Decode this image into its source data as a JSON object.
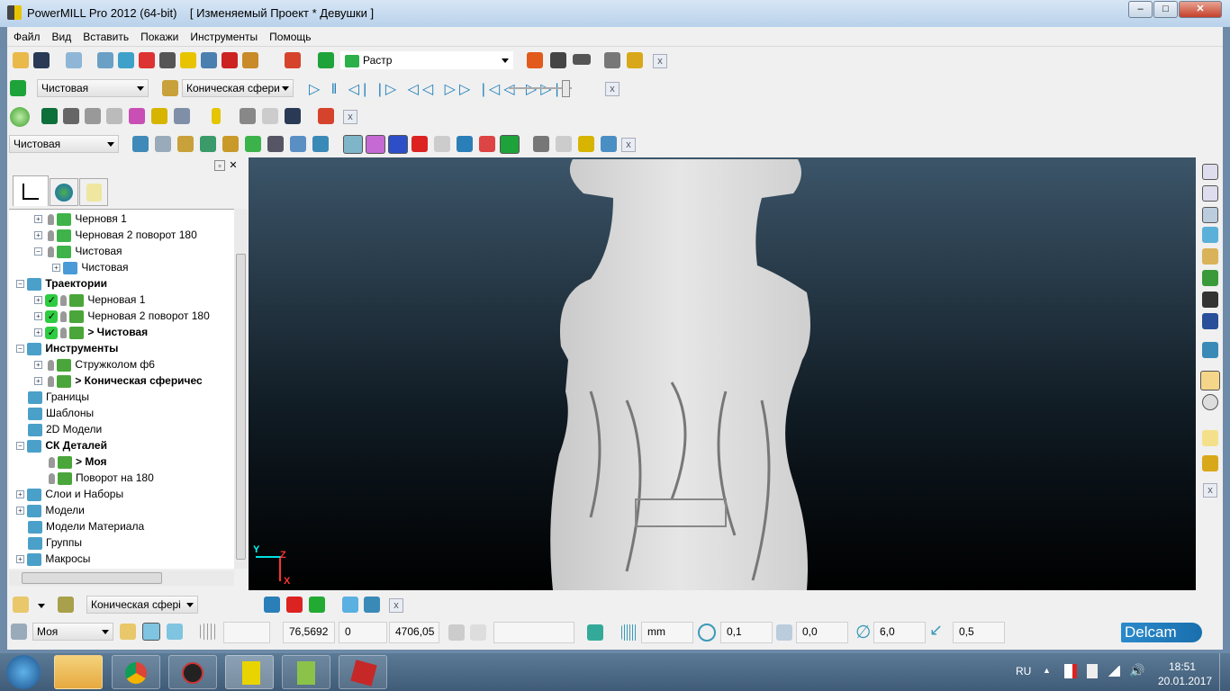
{
  "window": {
    "app_title": "PowerMILL Pro 2012 (64-bit)",
    "project_title": "[ Изменяемый Проект * Девушки ]",
    "minimize": "–",
    "maximize": "□",
    "close": "✕"
  },
  "menu": [
    "Файл",
    "Вид",
    "Вставить",
    "Покажи",
    "Инструменты",
    "Помощь"
  ],
  "toolbar": {
    "strategy_combo": "Растр",
    "toolpath_combo": "Чистовая",
    "tool_combo": "Коническая сфери",
    "boundary_combo": "Чистовая",
    "close": "x",
    "slider_position": 0.95
  },
  "explorer": {
    "tabs": [
      "tree-icon",
      "globe-icon",
      "recycle-icon"
    ],
    "items": [
      {
        "label": "Черновя 1",
        "level": 2,
        "expand": "+",
        "bold": false
      },
      {
        "label": "Черновая 2  поворот 180",
        "level": 2,
        "expand": "+",
        "bold": false
      },
      {
        "label": "Чистовая",
        "level": 2,
        "expand": "−",
        "bold": false
      },
      {
        "label": "Чистовая",
        "level": 3,
        "expand": "+",
        "bold": false
      },
      {
        "label": "Траектории",
        "level": 0,
        "expand": "−",
        "bold": true
      },
      {
        "label": "Черновая 1",
        "level": 1,
        "expand": "+",
        "bold": false,
        "check": true
      },
      {
        "label": "Черновая 2 поворот 180",
        "level": 1,
        "expand": "+",
        "bold": false,
        "check": true
      },
      {
        "label": "> Чистовая",
        "level": 1,
        "expand": "+",
        "bold": true,
        "check": true
      },
      {
        "label": "Инструменты",
        "level": 0,
        "expand": "−",
        "bold": true
      },
      {
        "label": "Стружколом ф6",
        "level": 1,
        "expand": "+",
        "bold": false
      },
      {
        "label": "> Коническая сферичес",
        "level": 1,
        "expand": "+",
        "bold": true
      },
      {
        "label": "Границы",
        "level": 0,
        "expand": "",
        "bold": false
      },
      {
        "label": "Шаблоны",
        "level": 0,
        "expand": "",
        "bold": false
      },
      {
        "label": "2D Модели",
        "level": 0,
        "expand": "",
        "bold": false
      },
      {
        "label": "СК Деталей",
        "level": 0,
        "expand": "−",
        "bold": true
      },
      {
        "label": "> Моя",
        "level": 1,
        "expand": "",
        "bold": true
      },
      {
        "label": "Поворот на 180",
        "level": 1,
        "expand": "",
        "bold": false
      },
      {
        "label": "Слои и Наборы",
        "level": 0,
        "expand": "+",
        "bold": false
      },
      {
        "label": "Модели",
        "level": 0,
        "expand": "+",
        "bold": false
      },
      {
        "label": "Модели Материала",
        "level": 0,
        "expand": "",
        "bold": false
      },
      {
        "label": "Группы",
        "level": 0,
        "expand": "",
        "bold": false
      },
      {
        "label": "Макросы",
        "level": 0,
        "expand": "+",
        "bold": false
      }
    ]
  },
  "viewport": {
    "axis_x": "X",
    "axis_y": "Y",
    "axis_z": "Z"
  },
  "bottom_toolbar": {
    "tool_combo": "Коническая сфері",
    "close": "x"
  },
  "status": {
    "workplane_combo": "Моя",
    "x": "76,5692",
    "y": "0",
    "z": "4706,05",
    "units": "mm",
    "tolerance": "0,1",
    "thickness": "0,0",
    "diameter": "6,0",
    "stepover": "0,5",
    "logo": "Delcam"
  },
  "taskbar": {
    "lang": "RU",
    "time": "18:51",
    "date": "20.01.2017"
  }
}
